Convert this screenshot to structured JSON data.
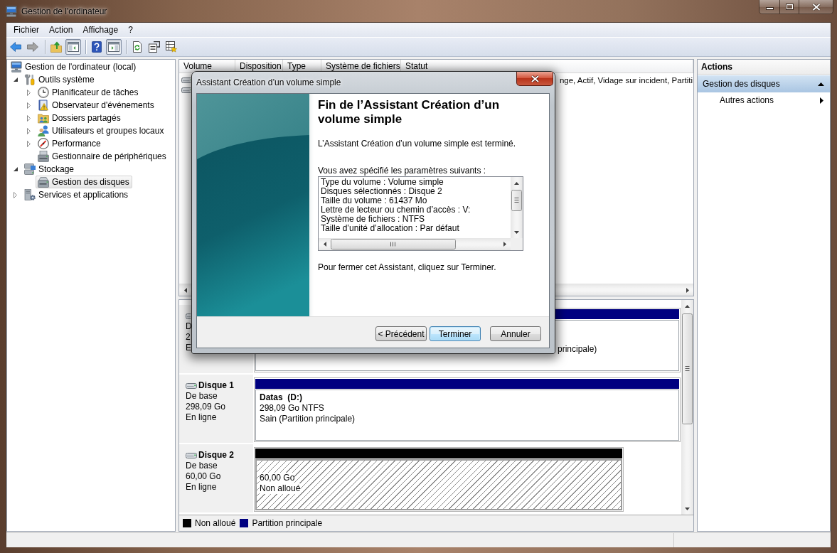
{
  "window": {
    "title": "Gestion de l'ordinateur"
  },
  "menu": [
    "Fichier",
    "Action",
    "Affichage",
    "?"
  ],
  "toolbar": {
    "groups": [
      [
        {
          "pressed": false,
          "disabled": false
        },
        {
          "pressed": false,
          "disabled": true
        }
      ],
      [
        {
          "pressed": false,
          "disabled": false
        },
        {
          "pressed": true,
          "disabled": false
        }
      ],
      [
        {
          "pressed": false,
          "disabled": false
        },
        {
          "pressed": true,
          "disabled": false
        }
      ],
      [
        {
          "pressed": false,
          "disabled": false
        },
        {
          "pressed": false,
          "disabled": false
        },
        {
          "pressed": false,
          "disabled": false
        }
      ]
    ]
  },
  "tree": [
    {
      "label": "Gestion de l'ordinateur (local)",
      "selected": false,
      "children": [
        {
          "label": "Outils système",
          "expanded": true,
          "selected": false,
          "children": [
            {
              "label": "Planificateur de tâches",
              "expanded": false,
              "selected": false
            },
            {
              "label": "Observateur d'événements",
              "expanded": false,
              "selected": false
            },
            {
              "label": "Dossiers partagés",
              "expanded": false,
              "selected": false
            },
            {
              "label": "Utilisateurs et groupes locaux",
              "expanded": false,
              "selected": false
            },
            {
              "label": "Performance",
              "expanded": false,
              "selected": false
            },
            {
              "label": "Gestionnaire de périphériques",
              "selected": false
            }
          ]
        },
        {
          "label": "Stockage",
          "expanded": true,
          "selected": false,
          "children": [
            {
              "label": "Gestion des disques",
              "selected": true
            }
          ]
        },
        {
          "label": "Services et applications",
          "expanded": false,
          "selected": false
        }
      ]
    }
  ],
  "volume_list": {
    "columns": [
      "Volume",
      "Disposition",
      "Type",
      "Système de fichiers",
      "Statut"
    ],
    "rows": [
      {
        "statut": "nge, Actif, Vidage sur incident, Partiti"
      },
      {}
    ]
  },
  "disk_view": {
    "disks": [
      {
        "info": [
          "D",
          "2",
          "E"
        ],
        "partitions": [
          {
            "kind": "primary",
            "status": "principale)"
          }
        ]
      },
      {
        "name": "Disque 1",
        "info": [
          "De base",
          "298,09 Go",
          "En ligne"
        ],
        "partitions": [
          {
            "kind": "primary",
            "title": "Datas  (D:)",
            "size": "298,09 Go NTFS",
            "status": "Sain (Partition principale)"
          }
        ]
      },
      {
        "name": "Disque 2",
        "info": [
          "De base",
          "60,00 Go",
          "En ligne"
        ],
        "partitions": [
          {
            "kind": "unallocated",
            "size": "60,00 Go",
            "status": "Non alloué"
          }
        ]
      }
    ],
    "legend": [
      {
        "label": "Non alloué",
        "color": "#000000"
      },
      {
        "label": "Partition principale",
        "color": "#000080"
      }
    ]
  },
  "actions": {
    "title": "Actions",
    "section": {
      "label": "Gestion des disques",
      "expanded": true
    },
    "items": [
      "Autres actions"
    ]
  },
  "dialog": {
    "title": "Assistant Création d’un volume simple",
    "heading": "Fin de l’Assistant Création d’un volume simple",
    "intro": "L’Assistant Création d’un volume simple est terminé.",
    "summary_label": "Vous avez spécifié les paramètres suivants :",
    "summary": [
      "Type du volume : Volume simple",
      "Disques sélectionnés : Disque 2",
      "Taille du volume : 61437 Mo",
      "Lettre de lecteur ou chemin d’accès : V:",
      "Système de fichiers : NTFS",
      "Taille d’unité d’allocation : Par défaut"
    ],
    "closing": "Pour fermer cet Assistant, cliquez sur Terminer.",
    "buttons": [
      {
        "label": "< Précédent",
        "default": false
      },
      {
        "label": "Terminer",
        "default": true
      },
      {
        "label": "Annuler",
        "default": false
      }
    ]
  }
}
